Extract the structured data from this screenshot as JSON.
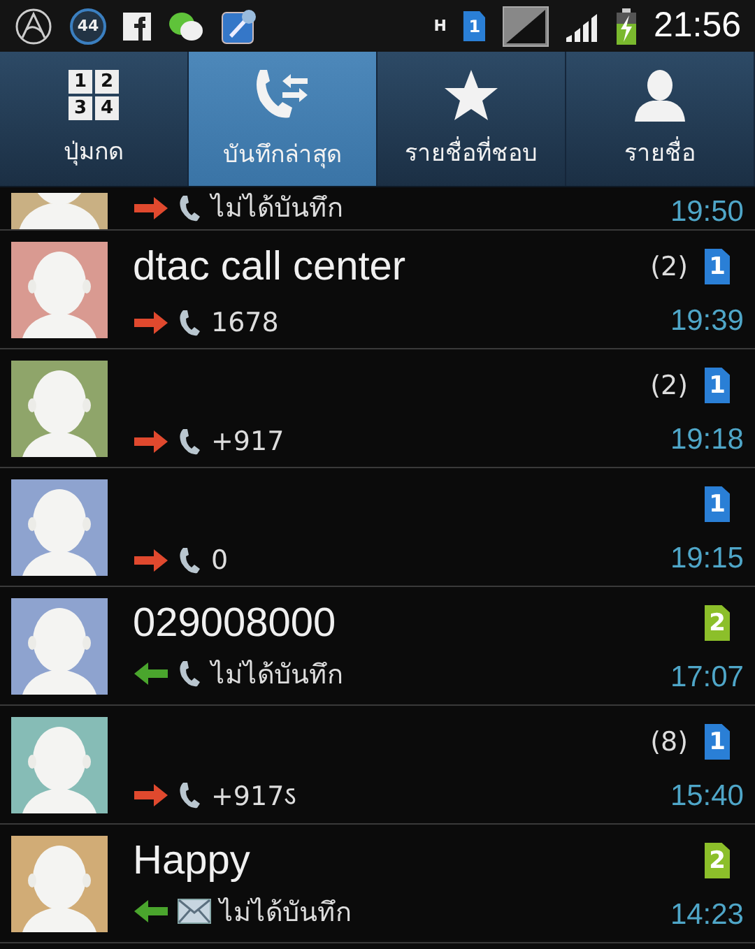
{
  "status_bar": {
    "badge": "44",
    "network": "H",
    "sim": "1",
    "time": "21:56"
  },
  "tabs": [
    {
      "kind": "keypad",
      "keys": [
        "1",
        "2",
        "3",
        "4"
      ],
      "label": "ปุ่มกด",
      "selected": false
    },
    {
      "kind": "logs",
      "label": "บันทึกล่าสุด",
      "selected": true
    },
    {
      "kind": "favorites",
      "label": "รายชื่อที่ชอบ",
      "selected": false
    },
    {
      "kind": "contacts",
      "label": "รายชื่อ",
      "selected": false
    }
  ],
  "log": [
    {
      "avatar": {
        "color": "#c9b083"
      },
      "outgoing": true,
      "kind": "call",
      "detail": "ไม่ได้บันทึก",
      "time": "19:50"
    },
    {
      "avatar": {
        "color": "#d99a91"
      },
      "name": "dtac call center",
      "count": "(2)",
      "sim": {
        "label": "1",
        "color": "#2a7fd6"
      },
      "outgoing": true,
      "kind": "call",
      "detail": "1678",
      "time": "19:39"
    },
    {
      "avatar": {
        "color": "#8fa56a"
      },
      "count": "(2)",
      "sim": {
        "label": "1",
        "color": "#2a7fd6"
      },
      "outgoing": true,
      "kind": "call",
      "detail": "+917",
      "time": "19:18"
    },
    {
      "avatar": {
        "color": "#8ea3cf"
      },
      "sim": {
        "label": "1",
        "color": "#2a7fd6"
      },
      "outgoing": true,
      "kind": "call",
      "detail": "0",
      "time": "19:15"
    },
    {
      "avatar": {
        "color": "#8ea3cf"
      },
      "name": "029008000",
      "sim": {
        "label": "2",
        "color": "#8cbf2a"
      },
      "outgoing": false,
      "kind": "call",
      "detail": "ไม่ได้บันทึก",
      "time": "17:07"
    },
    {
      "avatar": {
        "color": "#86bcb6"
      },
      "count": "(8)",
      "sim": {
        "label": "1",
        "color": "#2a7fd6"
      },
      "outgoing": true,
      "kind": "call",
      "detail": "+917ऽ",
      "time": "15:40"
    },
    {
      "avatar": {
        "color": "#d1ac76"
      },
      "name": "Happy",
      "sim": {
        "label": "2",
        "color": "#8cbf2a"
      },
      "outgoing": false,
      "kind": "message",
      "detail": "ไม่ได้บันทึก",
      "time": "14:23"
    }
  ]
}
